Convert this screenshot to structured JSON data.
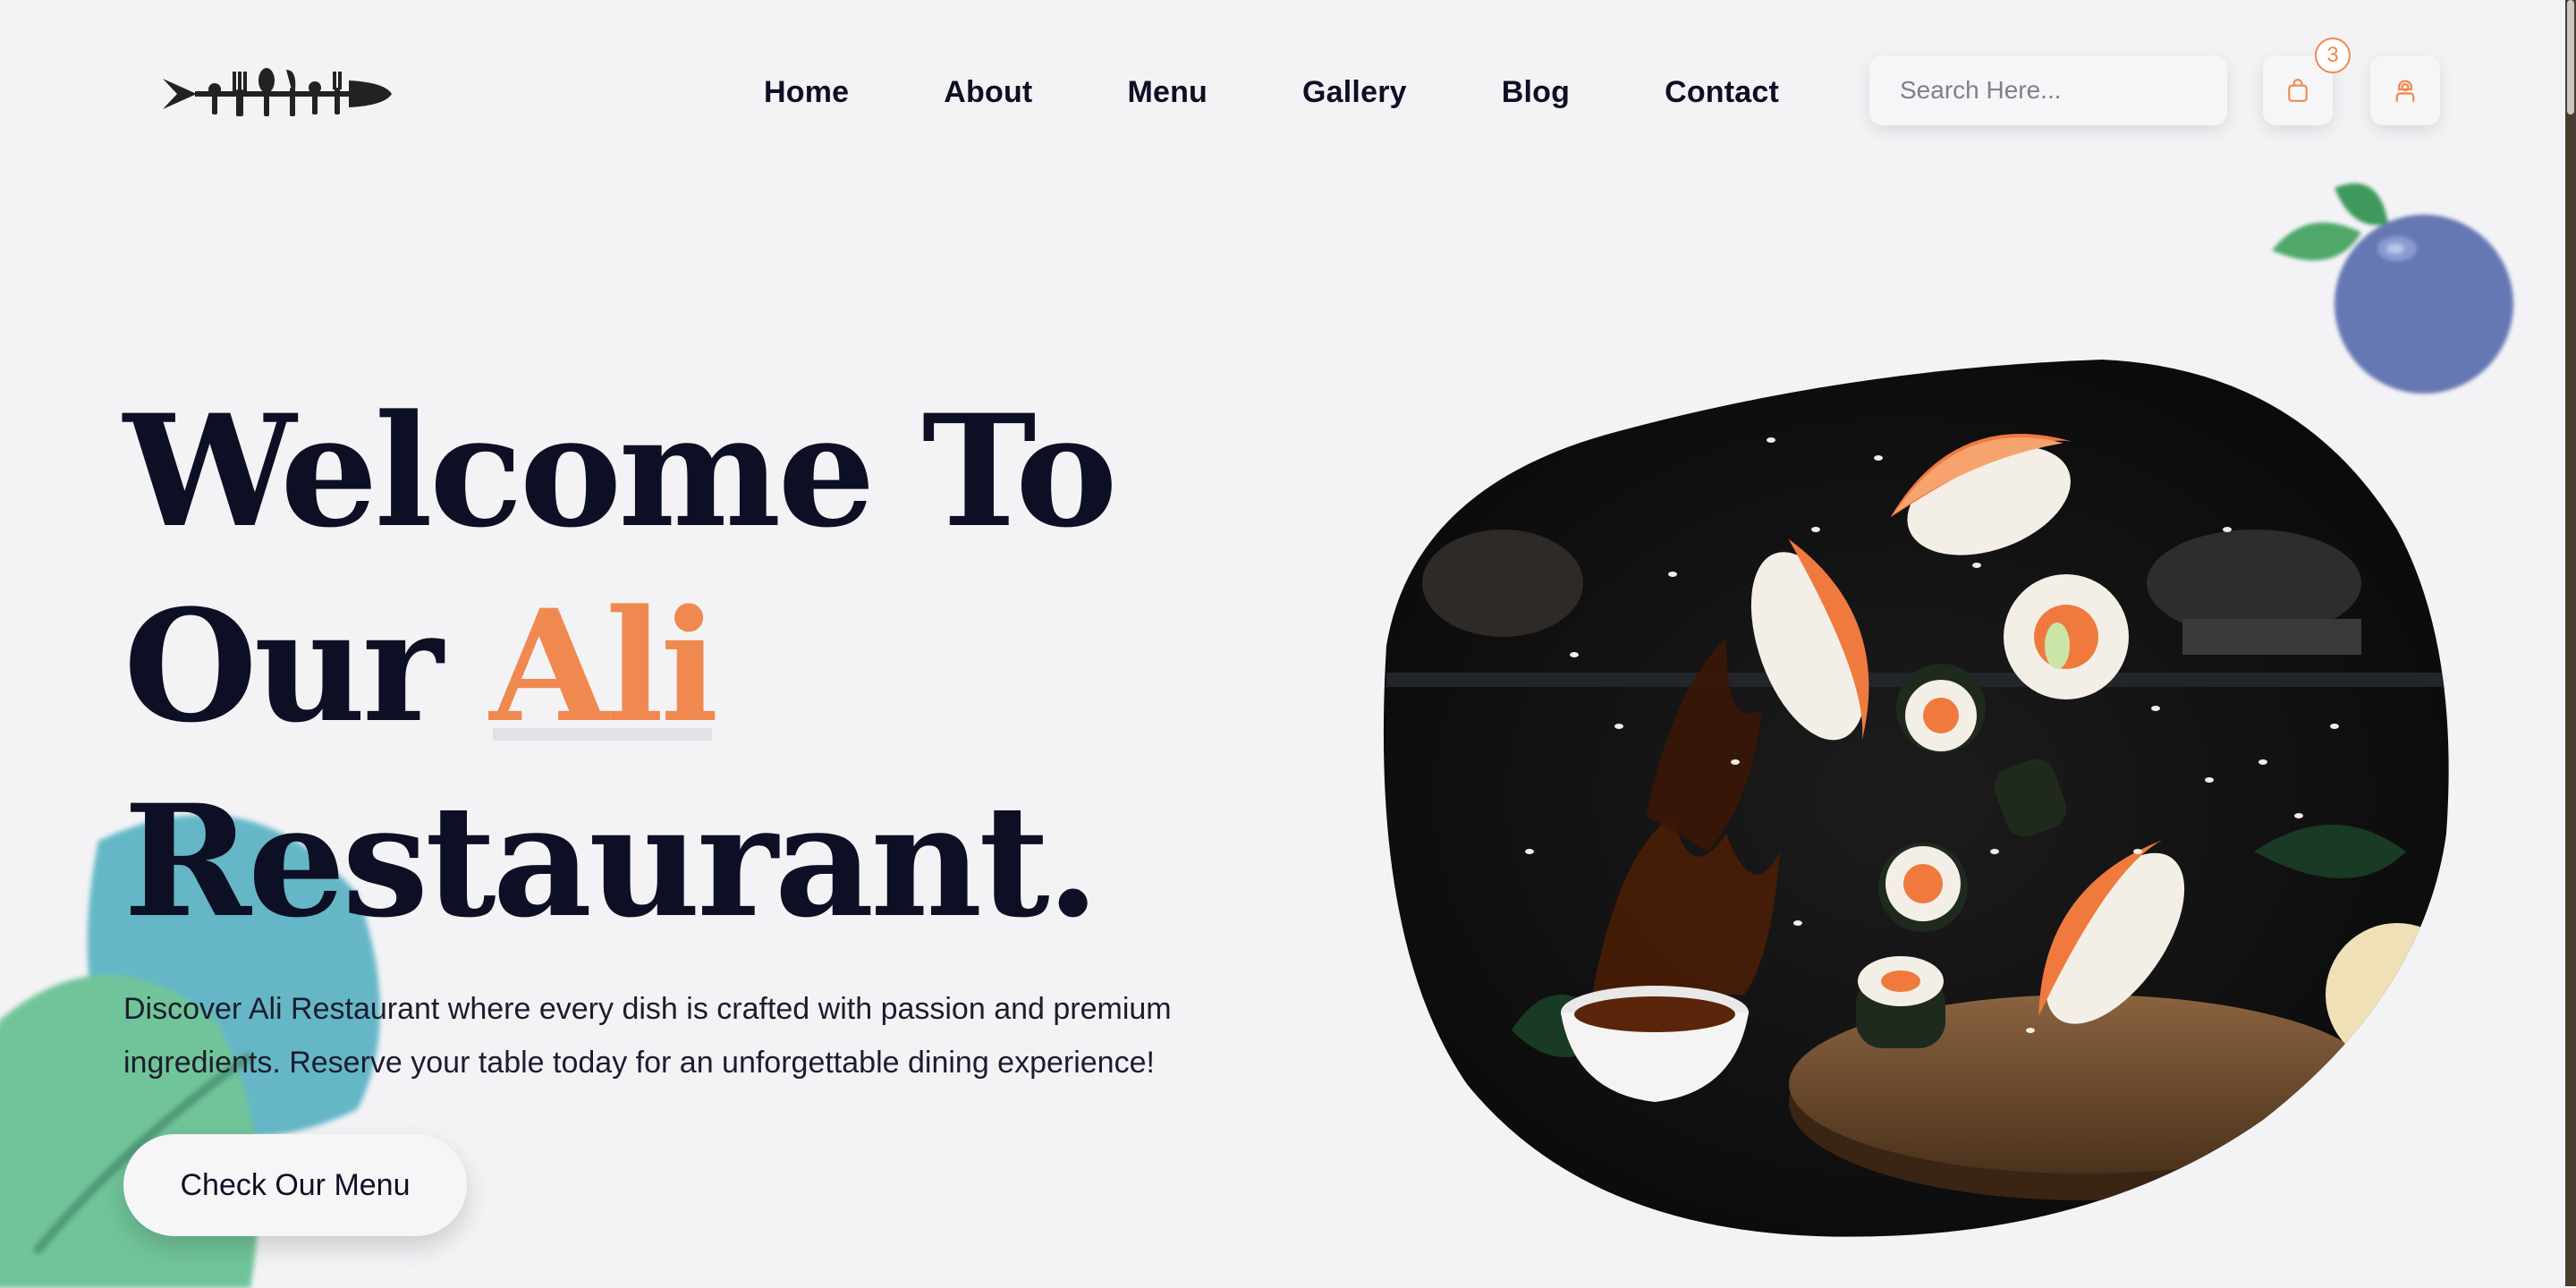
{
  "brand": {
    "logo_name": "cutlery-fish-logo"
  },
  "nav": {
    "items": [
      {
        "label": "Home"
      },
      {
        "label": "About"
      },
      {
        "label": "Menu"
      },
      {
        "label": "Gallery"
      },
      {
        "label": "Blog"
      },
      {
        "label": "Contact"
      }
    ]
  },
  "search": {
    "placeholder": "Search Here...",
    "icon": "search-icon"
  },
  "cart": {
    "count": "3",
    "icon": "shopping-bag-icon"
  },
  "user": {
    "icon": "user-icon"
  },
  "hero": {
    "title_line1": "Welcome To",
    "title_line2_prefix": "Our ",
    "title_line2_accent": "Ali",
    "title_line3": "Restaurant.",
    "description": "Discover Ali Restaurant where every dish is crafted with passion and premium ingredients. Reserve your table today for an unforgettable dining experience!",
    "cta_label": "Check Our Menu",
    "image_subject": "flying sushi with soy sauce splash over wooden board"
  },
  "colors": {
    "accent": "#f0894f",
    "text_dark": "#0d0f24",
    "background": "#f3f3f6",
    "berry": "#6678b3",
    "leaf": "#5fb98a"
  }
}
